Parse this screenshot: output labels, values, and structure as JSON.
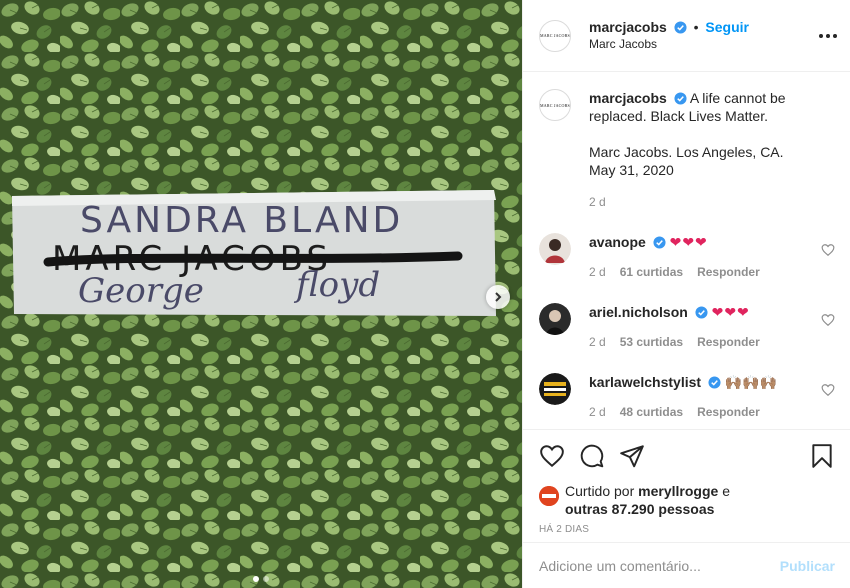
{
  "post": {
    "sign_lines": [
      "SANDRA BLAND",
      "MARC JACOBS",
      "George",
      "floyd"
    ],
    "carousel": {
      "slides": 2,
      "active": 1
    }
  },
  "header": {
    "username": "marcjacobs",
    "separator": "•",
    "follow_label": "Seguir",
    "subtitle": "Marc Jacobs",
    "avatar_text": "MARC JACOBS"
  },
  "caption": {
    "username": "marcjacobs",
    "text1": "A life cannot be replaced. Black Lives Matter.",
    "text2": "Marc Jacobs. Los Angeles, CA. May 31, 2020",
    "age": "2 d"
  },
  "comments": [
    {
      "username": "avanope",
      "text": "❤❤❤",
      "age": "2 d",
      "likes": "61 curtidas",
      "reply": "Responder"
    },
    {
      "username": "ariel.nicholson",
      "text": "❤❤❤",
      "age": "2 d",
      "likes": "53 curtidas",
      "reply": "Responder"
    },
    {
      "username": "karlawelchstylist",
      "text": "🙌🏽🙌🏽🙌🏽",
      "age": "2 d",
      "likes": "48 curtidas",
      "reply": "Responder"
    }
  ],
  "likes": {
    "prefix": "Curtido por",
    "user": "meryllrogge",
    "connector": "e",
    "others": "outras 87.290 pessoas"
  },
  "date": "HÁ 2 DIAS",
  "add_comment": {
    "placeholder": "Adicione um comentário...",
    "publish_label": "Publicar"
  },
  "icons": [
    "verified-badge-icon",
    "more-options-icon",
    "heart-icon",
    "comment-icon",
    "share-icon",
    "bookmark-icon",
    "chevron-right-icon"
  ]
}
